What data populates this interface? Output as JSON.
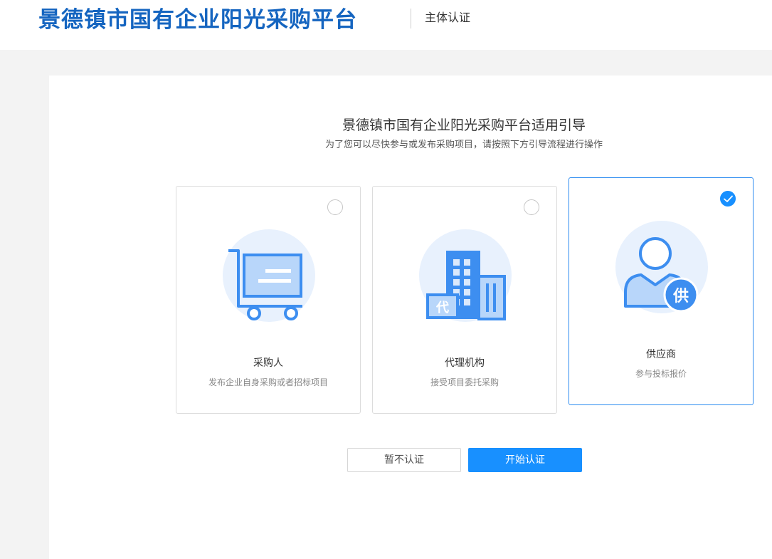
{
  "header": {
    "site_title": "景德镇市国有企业阳光采购平台",
    "subtitle": "主体认证"
  },
  "guide": {
    "title": "景德镇市国有企业阳光采购平台适用引导",
    "subtitle": "为了您可以尽快参与或发布采购项目，请按照下方引导流程进行操作"
  },
  "roles": [
    {
      "id": "purchaser",
      "label": "采购人",
      "desc": "发布企业自身采购或者招标项目",
      "icon": "shopping-cart-icon",
      "selected": false
    },
    {
      "id": "agency",
      "label": "代理机构",
      "desc": "接受项目委托采购",
      "icon": "building-agency-icon",
      "selected": false,
      "icon_badge": "代"
    },
    {
      "id": "supplier",
      "label": "供应商",
      "desc": "参与投标报价",
      "icon": "user-supplier-icon",
      "selected": true,
      "icon_badge": "供"
    }
  ],
  "buttons": {
    "skip": "暂不认证",
    "start": "开始认证"
  },
  "colors": {
    "brand": "#1565c0",
    "accent": "#1890ff",
    "icon_fill": "#3d8ef0",
    "icon_bg": "#e8f1fd"
  }
}
